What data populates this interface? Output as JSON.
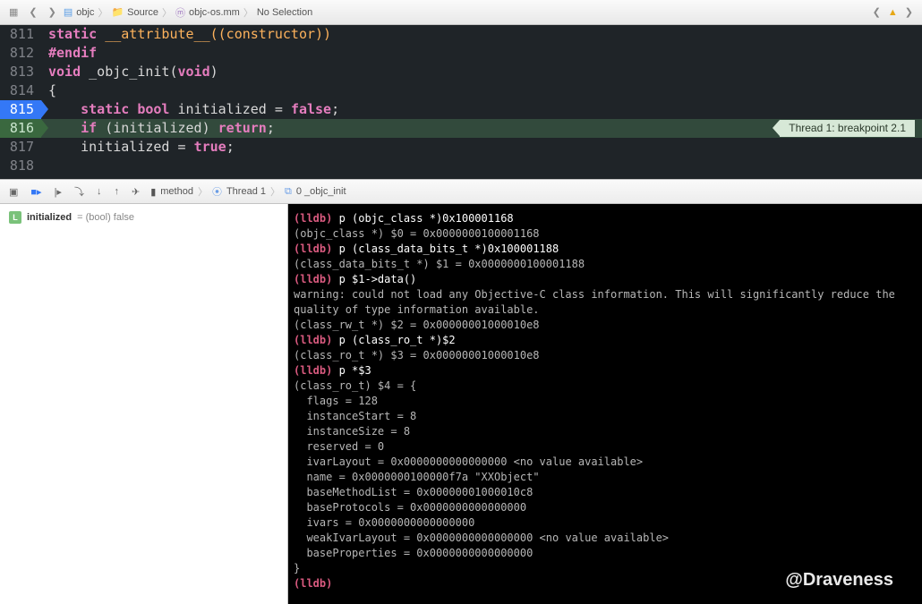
{
  "breadcrumbs": {
    "item1": "objc",
    "item2": "Source",
    "item3": "objc-os.mm",
    "item4": "No Selection"
  },
  "editor": {
    "ln811": "811",
    "ln812": "812",
    "ln813": "813",
    "ln814": "814",
    "ln815": "815",
    "ln816": "816",
    "ln817": "817",
    "ln818": "818",
    "l811_kw": "static",
    "l811_attr": "__attribute__",
    "l811_rest": "((constructor))",
    "l812": "#endif",
    "l813_kw": "void",
    "l813_fn": "_objc_init",
    "l813_arg": "void",
    "l814": "{",
    "l815_static": "static",
    "l815_bool": "bool",
    "l815_id": "initialized",
    "l815_eq": "=",
    "l815_false": "false",
    "l816_if": "if",
    "l816_cond": "(initialized)",
    "l816_ret": "return",
    "l817_id": "initialized",
    "l817_eq": "=",
    "l817_true": "true",
    "semicolon": ";",
    "breakpoint_label": "Thread 1: breakpoint 2.1"
  },
  "debugbar": {
    "method": "method",
    "thread": "Thread 1",
    "frame": "0 _objc_init"
  },
  "vars": {
    "badge": "L",
    "name": "initialized",
    "value": "= (bool) false"
  },
  "console": {
    "lines": [
      {
        "p": "(lldb) ",
        "c": "p (objc_class *)0x100001168"
      },
      {
        "o": "(objc_class *) $0 = 0x0000000100001168"
      },
      {
        "p": "(lldb) ",
        "c": "p (class_data_bits_t *)0x100001188"
      },
      {
        "o": "(class_data_bits_t *) $1 = 0x0000000100001188"
      },
      {
        "p": "(lldb) ",
        "c": "p $1->data()"
      },
      {
        "o": "warning: could not load any Objective-C class information. This will significantly reduce the quality of type information available."
      },
      {
        "o": "(class_rw_t *) $2 = 0x00000001000010e8"
      },
      {
        "p": "(lldb) ",
        "c": "p (class_ro_t *)$2"
      },
      {
        "o": "(class_ro_t *) $3 = 0x00000001000010e8"
      },
      {
        "p": "(lldb) ",
        "c": "p *$3"
      },
      {
        "o": "(class_ro_t) $4 = {"
      },
      {
        "o": "  flags = 128"
      },
      {
        "o": "  instanceStart = 8"
      },
      {
        "o": "  instanceSize = 8"
      },
      {
        "o": "  reserved = 0"
      },
      {
        "o": "  ivarLayout = 0x0000000000000000 <no value available>"
      },
      {
        "o": "  name = 0x0000000100000f7a \"XXObject\""
      },
      {
        "o": "  baseMethodList = 0x00000001000010c8"
      },
      {
        "o": "  baseProtocols = 0x0000000000000000"
      },
      {
        "o": "  ivars = 0x0000000000000000"
      },
      {
        "o": "  weakIvarLayout = 0x0000000000000000 <no value available>"
      },
      {
        "o": "  baseProperties = 0x0000000000000000"
      },
      {
        "o": "}"
      },
      {
        "p": "(lldb) ",
        "c": ""
      }
    ]
  },
  "watermark": "@Draveness"
}
